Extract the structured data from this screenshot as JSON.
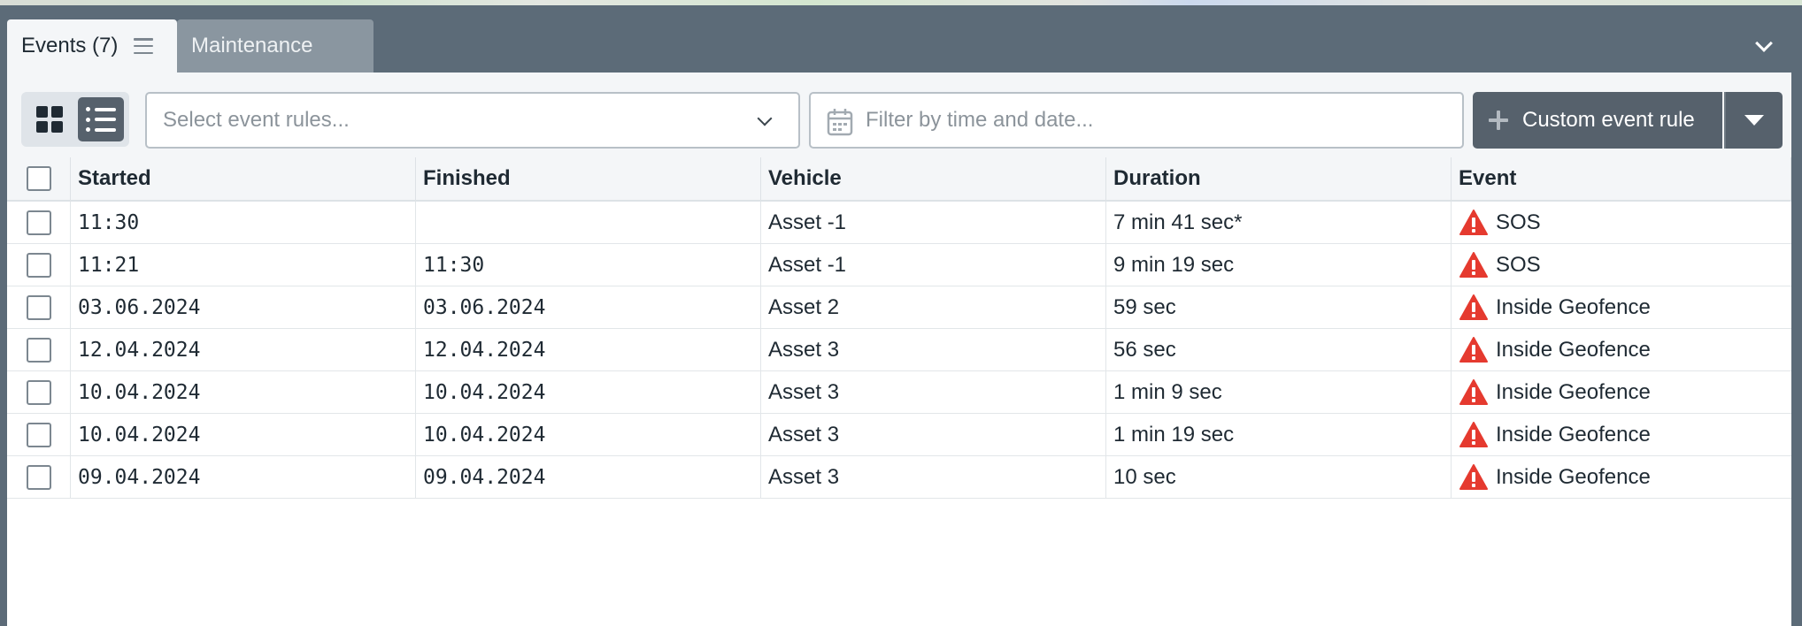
{
  "tabs": {
    "events_label": "Events (7)",
    "maintenance_label": "Maintenance"
  },
  "toolbar": {
    "select_placeholder": "Select event rules...",
    "date_placeholder": "Filter by time and date...",
    "custom_button_label": "Custom event rule"
  },
  "columns": {
    "started": "Started",
    "finished": "Finished",
    "vehicle": "Vehicle",
    "duration": "Duration",
    "event": "Event"
  },
  "rows": [
    {
      "started": "11:30",
      "finished": "",
      "vehicle": "Asset -1",
      "duration": "7 min 41 sec*",
      "event": "SOS"
    },
    {
      "started": "11:21",
      "finished": "11:30",
      "vehicle": "Asset -1",
      "duration": "9 min 19 sec",
      "event": "SOS"
    },
    {
      "started": "03.06.2024",
      "finished": "03.06.2024",
      "vehicle": "Asset 2",
      "duration": "59 sec",
      "event": "Inside Geofence"
    },
    {
      "started": "12.04.2024",
      "finished": "12.04.2024",
      "vehicle": "Asset 3",
      "duration": "56 sec",
      "event": "Inside Geofence"
    },
    {
      "started": "10.04.2024",
      "finished": "10.04.2024",
      "vehicle": "Asset 3",
      "duration": "1 min 9 sec",
      "event": "Inside Geofence"
    },
    {
      "started": "10.04.2024",
      "finished": "10.04.2024",
      "vehicle": "Asset 3",
      "duration": "1 min 19 sec",
      "event": "Inside Geofence"
    },
    {
      "started": "09.04.2024",
      "finished": "09.04.2024",
      "vehicle": "Asset 3",
      "duration": "10 sec",
      "event": "Inside Geofence"
    }
  ],
  "colors": {
    "panel_background": "#5c6b78",
    "active_view_button": "#56616c",
    "warning_red": "#e53a2f"
  },
  "icons": {
    "menu": "hamburger-icon",
    "collapse": "chevron-down-icon",
    "grid_view": "grid-icon",
    "list_view": "list-icon",
    "calendar": "calendar-icon",
    "add": "plus-icon",
    "event_status": "warning-triangle-icon"
  }
}
